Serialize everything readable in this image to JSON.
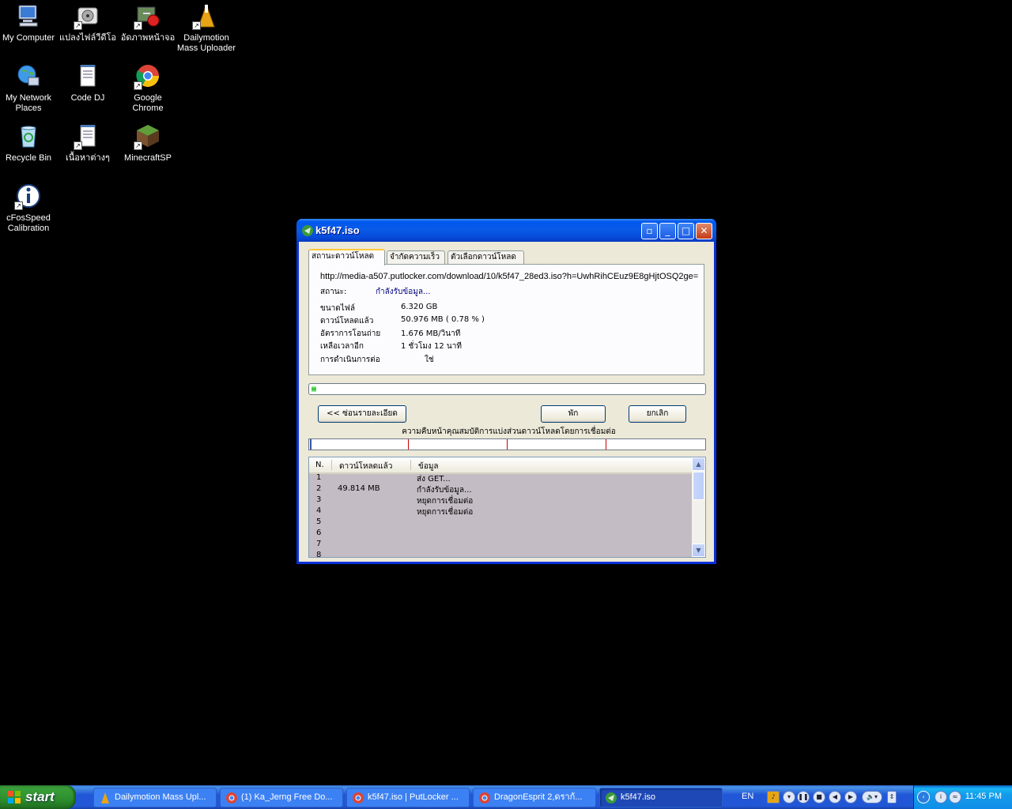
{
  "desktop": {
    "icons": [
      {
        "label": "My Computer"
      },
      {
        "label": "แปลงไฟล์วีดีโอ"
      },
      {
        "label": "อัดภาพหน้าจอ"
      },
      {
        "label": "Dailymotion Mass Uploader"
      },
      {
        "label": "My Network Places"
      },
      {
        "label": "Code DJ"
      },
      {
        "label": "Google Chrome"
      },
      {
        "label": "Recycle Bin"
      },
      {
        "label": "เนื้อหาต่างๆ"
      },
      {
        "label": "MinecraftSP"
      },
      {
        "label": "cFosSpeed Calibration"
      }
    ]
  },
  "window": {
    "title": "k5f47.iso",
    "tabs": [
      "สถานะดาวน์โหลด",
      "จำกัดความเร็ว",
      "ตัวเลือกดาวน์โหลด"
    ],
    "url": "http://media-a507.putlocker.com/download/10/k5f47_28ed3.iso?h=UwhRihCEuz9E8gHjtOSQ2ge=",
    "status_label": "สถานะ:",
    "status_value": "กำลังรับข้อมูล...",
    "info": {
      "file_size_label": "ขนาดไฟล์",
      "file_size": "6.320  GB",
      "downloaded_label": "ดาวน์โหลดแล้ว",
      "downloaded": "50.976  MB  ( 0.78 % )",
      "rate_label": "อัตราการโอนถ่าย",
      "rate": "1.676  MB/วินาที",
      "remaining_label": "เหลือเวลาอีก",
      "remaining": "1 ชั่วโมง 12 นาที",
      "resume_label": "การดำเนินการต่อ",
      "resume": "ใช่"
    },
    "progress_percent": 0.78,
    "buttons": {
      "hide_details": "<< ซ่อนรายละเอียด",
      "pause": "พัก",
      "cancel": "ยกเลิก"
    },
    "sections_caption": "ความคืบหน้าคุณสมบัติการแบ่งส่วนดาวน์โหลดโดยการเชื่อมต่อ",
    "connections": {
      "headers": [
        "N.",
        "ดาวน์โหลดแล้ว",
        "ข้อมูล"
      ],
      "rows": [
        {
          "n": "1",
          "downloaded": "",
          "info": "ส่ง GET..."
        },
        {
          "n": "2",
          "downloaded": "49.814  MB",
          "info": "กำลังรับข้อมูล..."
        },
        {
          "n": "3",
          "downloaded": "",
          "info": "หยุดการเชื่อมต่อ"
        },
        {
          "n": "4",
          "downloaded": "",
          "info": "หยุดการเชื่อมต่อ"
        },
        {
          "n": "5",
          "downloaded": "",
          "info": ""
        },
        {
          "n": "6",
          "downloaded": "",
          "info": ""
        },
        {
          "n": "7",
          "downloaded": "",
          "info": ""
        },
        {
          "n": "8",
          "downloaded": "",
          "info": ""
        }
      ]
    }
  },
  "taskbar": {
    "start_label": "start",
    "tasks": [
      {
        "label": "Dailymotion Mass Upl..."
      },
      {
        "label": "(1) Ka_Jerng Free Do..."
      },
      {
        "label": "k5f47.iso | PutLocker ..."
      },
      {
        "label": "DragonEsprit 2,ดราก้..."
      },
      {
        "label": "k5f47.iso"
      }
    ],
    "language": "EN",
    "clock": "11:45 PM"
  },
  "colors": {
    "title_blue": "#0058ee",
    "status_blue": "#00007f",
    "progress_green": "#2fbc2f",
    "start_green": "#379e37"
  }
}
